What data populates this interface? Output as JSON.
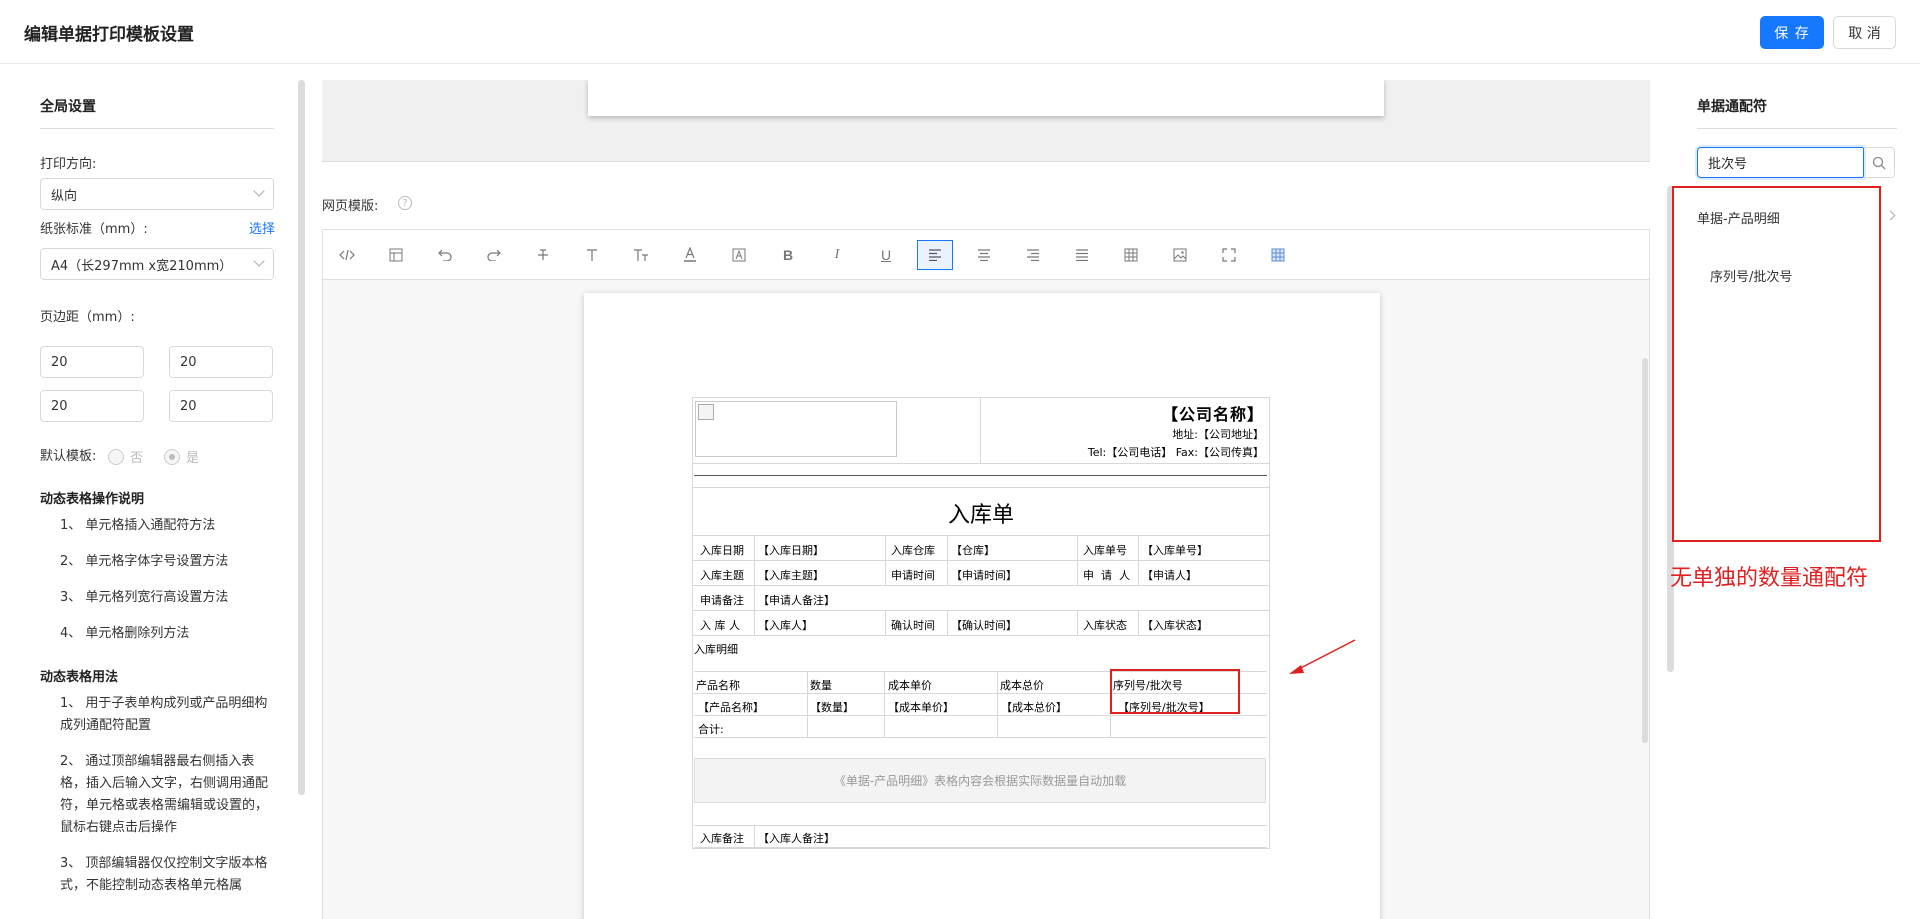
{
  "header": {
    "title": "编辑单据打印模板设置",
    "save_label": "保 存",
    "cancel_label": "取 消"
  },
  "left": {
    "global_title": "全局设置",
    "orientation_label": "打印方向:",
    "orientation_value": "纵向",
    "paper_label": "纸张标准（mm）:",
    "paper_select_link": "选择",
    "paper_value": "A4（长297mm x宽210mm）",
    "margin_label": "页边距（mm）:",
    "margins": [
      "20",
      "20",
      "20",
      "20"
    ],
    "default_label": "默认模板:",
    "default_no": "否",
    "default_yes": "是",
    "dyn_ops_title": "动态表格操作说明",
    "dyn_ops": [
      "1、 单元格插入通配符方法",
      "2、 单元格字体字号设置方法",
      "3、 单元格列宽行高设置方法",
      "4、 单元格删除列方法"
    ],
    "dyn_usage_title": "动态表格用法",
    "dyn_usage": [
      "1、 用于子表单构成列或产品明细构成列通配符配置",
      "2、 通过顶部编辑器最右侧插入表格，插入后输入文字，右侧调用通配符，单元格或表格需编辑或设置的，鼠标右键点击后操作",
      "3、 顶部编辑器仅仅控制文字版本格式，不能控制动态表格单元格属"
    ]
  },
  "center": {
    "web_template_label": "网页模版:",
    "help_glyph": "?",
    "doc": {
      "company": "【公司名称】",
      "address": "地址:【公司地址】",
      "tel_fax": "Tel:【公司电话】    Fax:【公司传真】",
      "title": "入库单",
      "rows": [
        [
          "入库日期",
          "【入库日期】",
          "入库仓库",
          "【仓库】",
          "入库单号",
          "【入库单号】"
        ],
        [
          "入库主题",
          "【入库主题】",
          "申请时间",
          "【申请时间】",
          "申  请  人",
          "【申请人】"
        ],
        [
          "申请备注",
          "【申请人备注】"
        ],
        [
          "入 库 人",
          "【入库人】",
          "确认时间",
          "【确认时间】",
          "入库状态",
          "【入库状态】"
        ]
      ],
      "detail_label": "入库明细",
      "detail_headers": [
        "产品名称",
        "数量",
        "成本单价",
        "成本总价",
        "序列号/批次号"
      ],
      "detail_values": [
        "【产品名称】",
        "【数量】",
        "【成本单价】",
        "【成本总价】",
        "【序列号/批次号】"
      ],
      "total_label": "合计:",
      "auto_load_note": "《单据-产品明细》表格内容会根据实际数据量自动加载",
      "remark_label": "入库备注",
      "remark_value": "【入库人备注】"
    }
  },
  "right": {
    "title": "单据通配符",
    "search_value": "批次号",
    "group_label": "单据-产品明细",
    "item_label": "序列号/批次号",
    "annotation": "无单独的数量通配符"
  },
  "colors": {
    "primary": "#1677ff",
    "annotation_red": "#e02020"
  }
}
